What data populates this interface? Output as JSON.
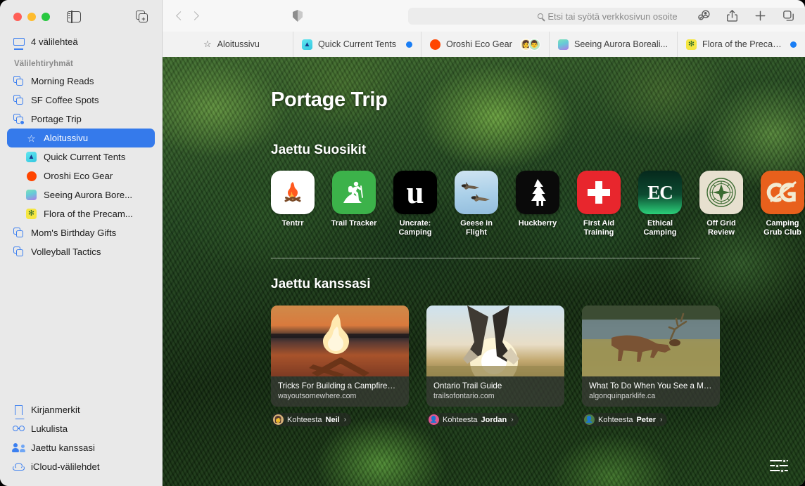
{
  "window": {
    "traffic_lights": [
      "close",
      "minimize",
      "zoom"
    ],
    "sidebar_toggle": "sidebar-toggle",
    "new_tab_group": "new-tab-group"
  },
  "sidebar": {
    "tabs_row": {
      "label": "4 välilehteä",
      "icon": "display-icon"
    },
    "section_header": "Välilehtiryhmät",
    "groups": [
      {
        "label": "Morning Reads",
        "icon": "tab-group-icon",
        "selected": false
      },
      {
        "label": "SF Coffee Spots",
        "icon": "tab-group-icon",
        "selected": false
      },
      {
        "label": "Portage Trip",
        "icon": "shared-tab-group-icon",
        "selected": false
      }
    ],
    "portage_children": [
      {
        "label": "Aloitussivu",
        "icon": "star-icon",
        "selected": true,
        "color": "#357aeb"
      },
      {
        "label": "Quick Current Tents",
        "icon": "site-favicon",
        "color": "#4fd8e8",
        "glyph": "⛺"
      },
      {
        "label": "Oroshi Eco Gear",
        "icon": "site-favicon",
        "color": "#ff4500",
        "shape": "circle"
      },
      {
        "label": "Seeing Aurora Bore...",
        "icon": "site-favicon",
        "color": "#7fe3b8"
      },
      {
        "label": "Flora of the Precam...",
        "icon": "site-favicon",
        "color": "#f5e642",
        "glyph": "✻"
      }
    ],
    "groups_after": [
      {
        "label": "Mom's Birthday Gifts",
        "icon": "tab-group-icon"
      },
      {
        "label": "Volleyball Tactics",
        "icon": "tab-group-icon"
      }
    ],
    "bottom": [
      {
        "label": "Kirjanmerkit",
        "icon": "bookmark-icon"
      },
      {
        "label": "Lukulista",
        "icon": "reading-list-glasses-icon"
      },
      {
        "label": "Jaettu kanssasi",
        "icon": "shared-with-you-people-icon"
      },
      {
        "label": "iCloud-välilehdet",
        "icon": "icloud-icon"
      }
    ]
  },
  "toolbar": {
    "back": "back-button",
    "forward": "forward-button",
    "privacy_shield": "privacy-report-icon",
    "address_bar": {
      "placeholder": "Etsi tai syötä verkkosivun osoite",
      "value": ""
    },
    "right_buttons": [
      {
        "name": "share-participants-icon"
      },
      {
        "name": "share-icon"
      },
      {
        "name": "new-tab-icon"
      },
      {
        "name": "tab-overview-icon"
      }
    ]
  },
  "tabbar": {
    "pinned": {
      "label": "Aloitussivu",
      "icon": "star-icon"
    },
    "tabs": [
      {
        "label": "Quick Current Tents",
        "favicon_color": "#4fd8e8",
        "glyph": "⛺",
        "badge": "blue-dot",
        "avatars": []
      },
      {
        "label": "Oroshi Eco Gear",
        "favicon_color": "#ff4500",
        "shape": "circle",
        "badge": "",
        "avatars": [
          "#f3dca0",
          "#7fc89a"
        ]
      },
      {
        "label": "Seeing Aurora Boreali...",
        "favicon_color": "#7fe3b8",
        "badge": "",
        "avatars": []
      },
      {
        "label": "Flora of the Precambi...",
        "favicon_color": "#f5e642",
        "glyph": "✻",
        "badge": "blue-dot",
        "avatars": []
      }
    ]
  },
  "startpage": {
    "title": "Portage Trip",
    "favorites_heading": "Jaettu Suosikit",
    "favorites": [
      {
        "label": "Tentrr",
        "bg": "#ffffff",
        "fg": "#ff5a1f",
        "glyph": "🔥"
      },
      {
        "label": "Trail Tracker",
        "bg": "#3cb24a",
        "fg": "#ffffff",
        "glyph": "🥾"
      },
      {
        "label": "Uncrate: Camping",
        "bg": "#000000",
        "fg": "#ffffff",
        "glyph": "u"
      },
      {
        "label": "Geese in Flight",
        "bg": "#a9cfe8",
        "fg": "#4a3b2a",
        "glyph": "🪿"
      },
      {
        "label": "Huckberry",
        "bg": "#000000",
        "fg": "#ffffff",
        "glyph": "🌲"
      },
      {
        "label": "First Aid Training",
        "bg": "#e8262d",
        "fg": "#ffffff",
        "glyph": "✚"
      },
      {
        "label": "Ethical Camping",
        "bg": "#0e3b2a",
        "fg": "#ffffff",
        "glyph": "EC"
      },
      {
        "label": "Off Grid Review",
        "bg": "#e7e0cf",
        "fg": "#3c6b32",
        "glyph": "✦"
      },
      {
        "label": "Camping Grub Club",
        "bg": "#e8601c",
        "fg": "#f0e7c8",
        "glyph": "CG"
      }
    ],
    "shared_heading": "Jaettu kanssasi",
    "shared_cards": [
      {
        "title": "Tricks For Building a Campfire—F...",
        "url": "wayoutsomewhere.com",
        "attrib_prefix": "Kohteesta",
        "attrib_name": "Neil",
        "avatar_color": "#d6b27a",
        "thumb": "campfire"
      },
      {
        "title": "Ontario Trail Guide",
        "url": "trailsofontario.com",
        "attrib_prefix": "Kohteesta",
        "attrib_name": "Jordan",
        "avatar_color": "#e0578f",
        "thumb": "hiker-sunset"
      },
      {
        "title": "What To Do When You See a Moo...",
        "url": "algonquinparklife.ca",
        "attrib_prefix": "Kohteesta",
        "attrib_name": "Peter",
        "avatar_color": "#4e7f4a",
        "thumb": "moose-lake"
      }
    ],
    "settings_button": "start-page-settings-icon"
  }
}
